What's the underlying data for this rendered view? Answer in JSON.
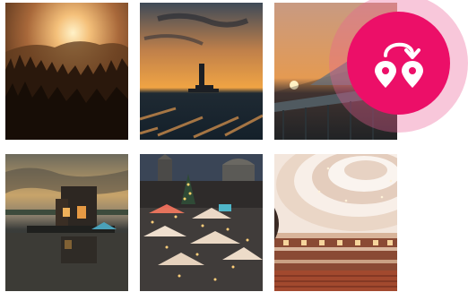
{
  "colors": {
    "accent": "#ec0f68",
    "accent_halo": "#eb5f96",
    "background": "#ffffff"
  },
  "tiles": [
    {
      "name": "sunrise-forest-photo"
    },
    {
      "name": "lighthouse-sunset-photo"
    },
    {
      "name": "pier-sunset-photo"
    },
    {
      "name": "floating-house-photo"
    },
    {
      "name": "christmas-market-photo"
    },
    {
      "name": "concert-hall-ceiling-photo"
    }
  ],
  "badge": {
    "icon": "route-pins-icon"
  }
}
